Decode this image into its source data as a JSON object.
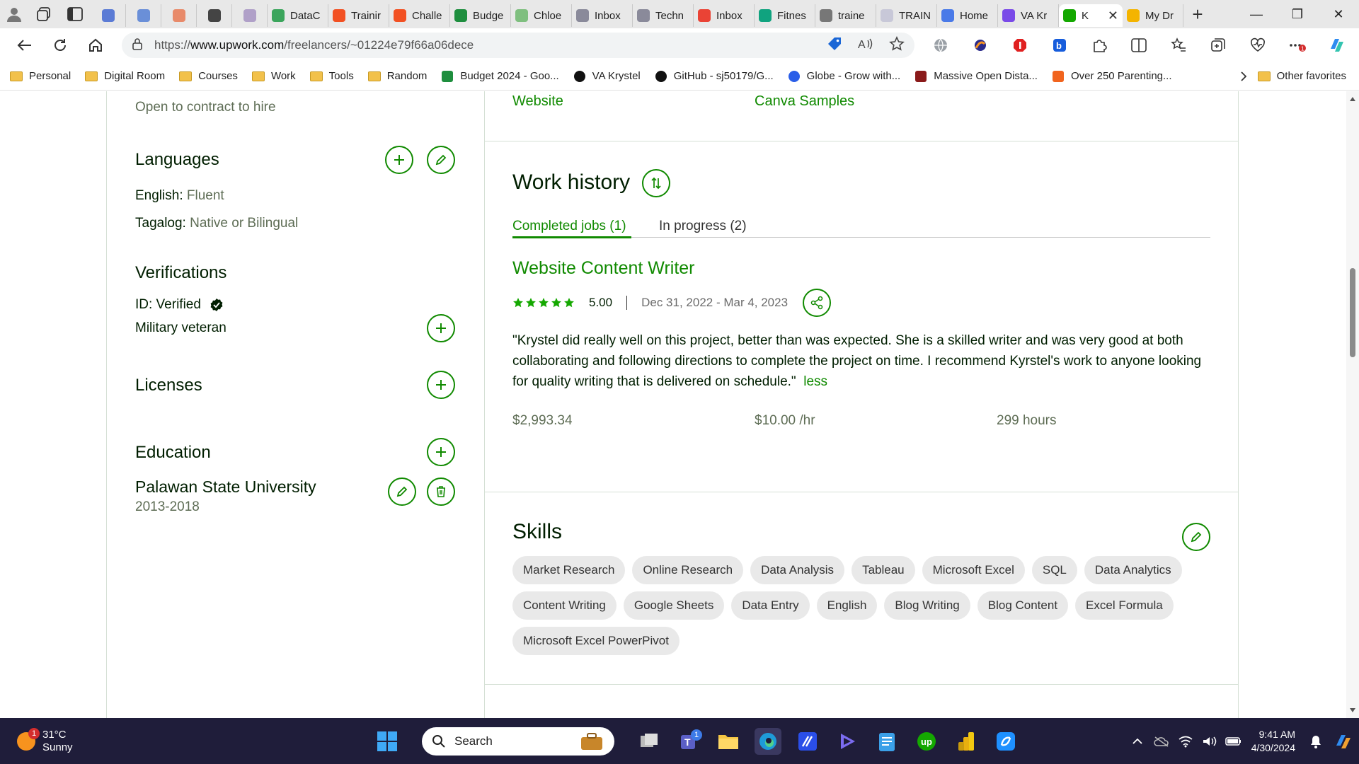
{
  "browser": {
    "tabs": [
      {
        "label": "",
        "icon": "edge-app-icon",
        "color": "#5b7bd5",
        "pinned": true
      },
      {
        "label": "",
        "icon": "chrome-app-icon",
        "color": "#6a8fd8",
        "pinned": true
      },
      {
        "label": "",
        "icon": "app-icon",
        "color": "#e88a6a",
        "pinned": true
      },
      {
        "label": "",
        "icon": "app-icon",
        "color": "#444444",
        "pinned": true
      },
      {
        "label": "",
        "icon": "app-icon",
        "color": "#b0a0c8",
        "pinned": true
      },
      {
        "label": "DataC",
        "icon": "datacamp-icon",
        "color": "#3ba55c"
      },
      {
        "label": "Trainir",
        "icon": "microsoft-icon",
        "color": "#f25022"
      },
      {
        "label": "Challe",
        "icon": "microsoft-icon",
        "color": "#f25022"
      },
      {
        "label": "Budge",
        "icon": "sheets-icon",
        "color": "#1e8e3e"
      },
      {
        "label": "Chloe",
        "icon": "globe-icon",
        "color": "#7fbf7f"
      },
      {
        "label": "Inbox",
        "icon": "globe-icon",
        "color": "#8a8a9a"
      },
      {
        "label": "Techn",
        "icon": "globe-icon",
        "color": "#8a8a9a"
      },
      {
        "label": "Inbox",
        "icon": "gmail-icon",
        "color": "#ea4335"
      },
      {
        "label": "Fitnes",
        "icon": "chatgpt-icon",
        "color": "#10a37f"
      },
      {
        "label": "traine",
        "icon": "search-icon",
        "color": "#777777"
      },
      {
        "label": "TRAIN",
        "icon": "app-icon",
        "color": "#c8c8d8"
      },
      {
        "label": "Home",
        "icon": "canva-icon",
        "color": "#4a7ae8"
      },
      {
        "label": "VA Kr",
        "icon": "app-icon",
        "color": "#7a4ae8"
      },
      {
        "label": "K",
        "icon": "upwork-icon",
        "color": "#14a800",
        "active": true
      },
      {
        "label": "My Dr",
        "icon": "drive-icon",
        "color": "#f4b400"
      }
    ],
    "window_controls": {
      "minimize": "—",
      "restore": "❐",
      "close": "✕"
    },
    "url_prefix": "https://",
    "url_host": "www.upwork.com",
    "url_path": "/freelancers/~01224e79f66a06dece",
    "favorites": [
      {
        "label": "Personal",
        "icon": "folder-icon"
      },
      {
        "label": "Digital Room",
        "icon": "folder-icon"
      },
      {
        "label": "Courses",
        "icon": "folder-icon"
      },
      {
        "label": "Work",
        "icon": "folder-icon"
      },
      {
        "label": "Tools",
        "icon": "folder-icon"
      },
      {
        "label": "Random",
        "icon": "folder-icon"
      },
      {
        "label": "Budget 2024 - Goo...",
        "icon": "sheets-icon"
      },
      {
        "label": "VA Krystel",
        "icon": "circle-c-icon"
      },
      {
        "label": "GitHub - sj50179/G...",
        "icon": "github-icon"
      },
      {
        "label": "Globe - Grow with...",
        "icon": "globe-c-icon"
      },
      {
        "label": "Massive Open Dista...",
        "icon": "mooc-icon"
      },
      {
        "label": "Over 250 Parenting...",
        "icon": "etsy-icon"
      }
    ],
    "other_favorites": "Other favorites"
  },
  "profile": {
    "availability": "Open to contract to hire",
    "languages": {
      "title": "Languages",
      "items": [
        {
          "name": "English:",
          "level": "Fluent"
        },
        {
          "name": "Tagalog:",
          "level": "Native or Bilingual"
        }
      ]
    },
    "verifications": {
      "title": "Verifications",
      "id_label": "ID: Verified",
      "military": "Military veteran"
    },
    "licenses": {
      "title": "Licenses"
    },
    "education": {
      "title": "Education",
      "school": "Palawan State University",
      "years": "2013-2018"
    },
    "portfolio_links": {
      "website": "Website",
      "canva": "Canva Samples"
    },
    "work_history": {
      "title": "Work history",
      "tab_completed": "Completed jobs (1)",
      "tab_in_progress": "In progress (2)",
      "job": {
        "title": "Website Content Writer",
        "rating": "5.00",
        "stars": 5,
        "dates": "Dec 31, 2022 - Mar 4, 2023",
        "feedback": "\"Krystel did really well on this project, better than was expected. She is a skilled writer and was very good at both collaborating and following directions to complete the project on time. I recommend Kyrstel's work to anyone looking for quality writing that is delivered on schedule.\"",
        "less_link": "less",
        "earned": "$2,993.34",
        "rate": "$10.00 /hr",
        "hours": "299 hours"
      }
    },
    "skills": {
      "title": "Skills",
      "items": [
        "Market Research",
        "Online Research",
        "Data Analysis",
        "Tableau",
        "Microsoft Excel",
        "SQL",
        "Data Analytics",
        "Content Writing",
        "Google Sheets",
        "Data Entry",
        "English",
        "Blog Writing",
        "Blog Content",
        "Excel Formula",
        "Microsoft Excel PowerPivot"
      ]
    }
  },
  "taskbar": {
    "weather_temp": "31°C",
    "weather_cond": "Sunny",
    "weather_badge": "1",
    "search_placeholder": "Search",
    "teams_badge": "1",
    "time": "9:41 AM",
    "date": "4/30/2024"
  },
  "colors": {
    "accent": "#108a00",
    "taskbar": "#1f1d3a"
  }
}
